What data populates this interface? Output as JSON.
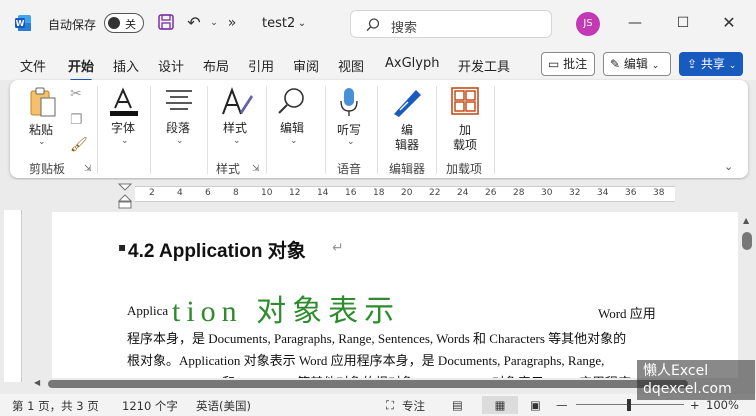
{
  "titlebar": {
    "autosave_label": "自动保存",
    "autosave_state": "关",
    "doc_name": "test2",
    "search_placeholder": "搜索",
    "avatar_initials": "JS",
    "more_glyph": "»"
  },
  "tabs": [
    "文件",
    "开始",
    "插入",
    "设计",
    "布局",
    "引用",
    "审阅",
    "视图",
    "AxGlyph",
    "开发工具"
  ],
  "active_tab": "开始",
  "right_buttons": {
    "comments": "批注",
    "editing": "编辑",
    "share": "共享"
  },
  "ribbon": {
    "paste": "粘贴",
    "font": "字体",
    "paragraph": "段落",
    "styles": "样式",
    "edit": "编辑",
    "dictate": "听写",
    "editor_l1": "编",
    "editor_l2": "辑器",
    "addins_l1": "加",
    "addins_l2": "载项",
    "groups": {
      "clipboard": "剪贴板",
      "styles": "样式",
      "voice": "语音",
      "editor": "编辑器",
      "addins": "加载项"
    }
  },
  "ruler_ticks": [
    "2",
    "4",
    "6",
    "8",
    "10",
    "12",
    "14",
    "16",
    "18",
    "20",
    "22",
    "24",
    "26",
    "28",
    "30",
    "32",
    "34",
    "36",
    "38"
  ],
  "document": {
    "heading": "4.2 Application  对象",
    "p1_a": "Applica",
    "p1_green": "tion 对象表示",
    "p1_c": "Word 应用",
    "line2": "程序本身，是 Documents, Paragraphs, Range, Sentences, Words 和 Characters 等其他对象的",
    "line3": "根对象。Application 对象表示 Word 应用程序本身，是 Documents, Paragraphs, Range,",
    "line4": "Sentences, Words 和 Characters 等其他对象的根对象。Application 对象表示 Word 应用程序"
  },
  "status": {
    "page": "第 1 页，共 3 页",
    "words": "1210 个字",
    "language": "英语(美国)",
    "focus": "专注",
    "zoom": "100%"
  },
  "watermark": {
    "line1": "懒人Excel",
    "line2": "dqexcel.com"
  },
  "colors": {
    "accent": "#185abd",
    "green_text": "#2e8b2e",
    "avatar": "#c239b3"
  }
}
